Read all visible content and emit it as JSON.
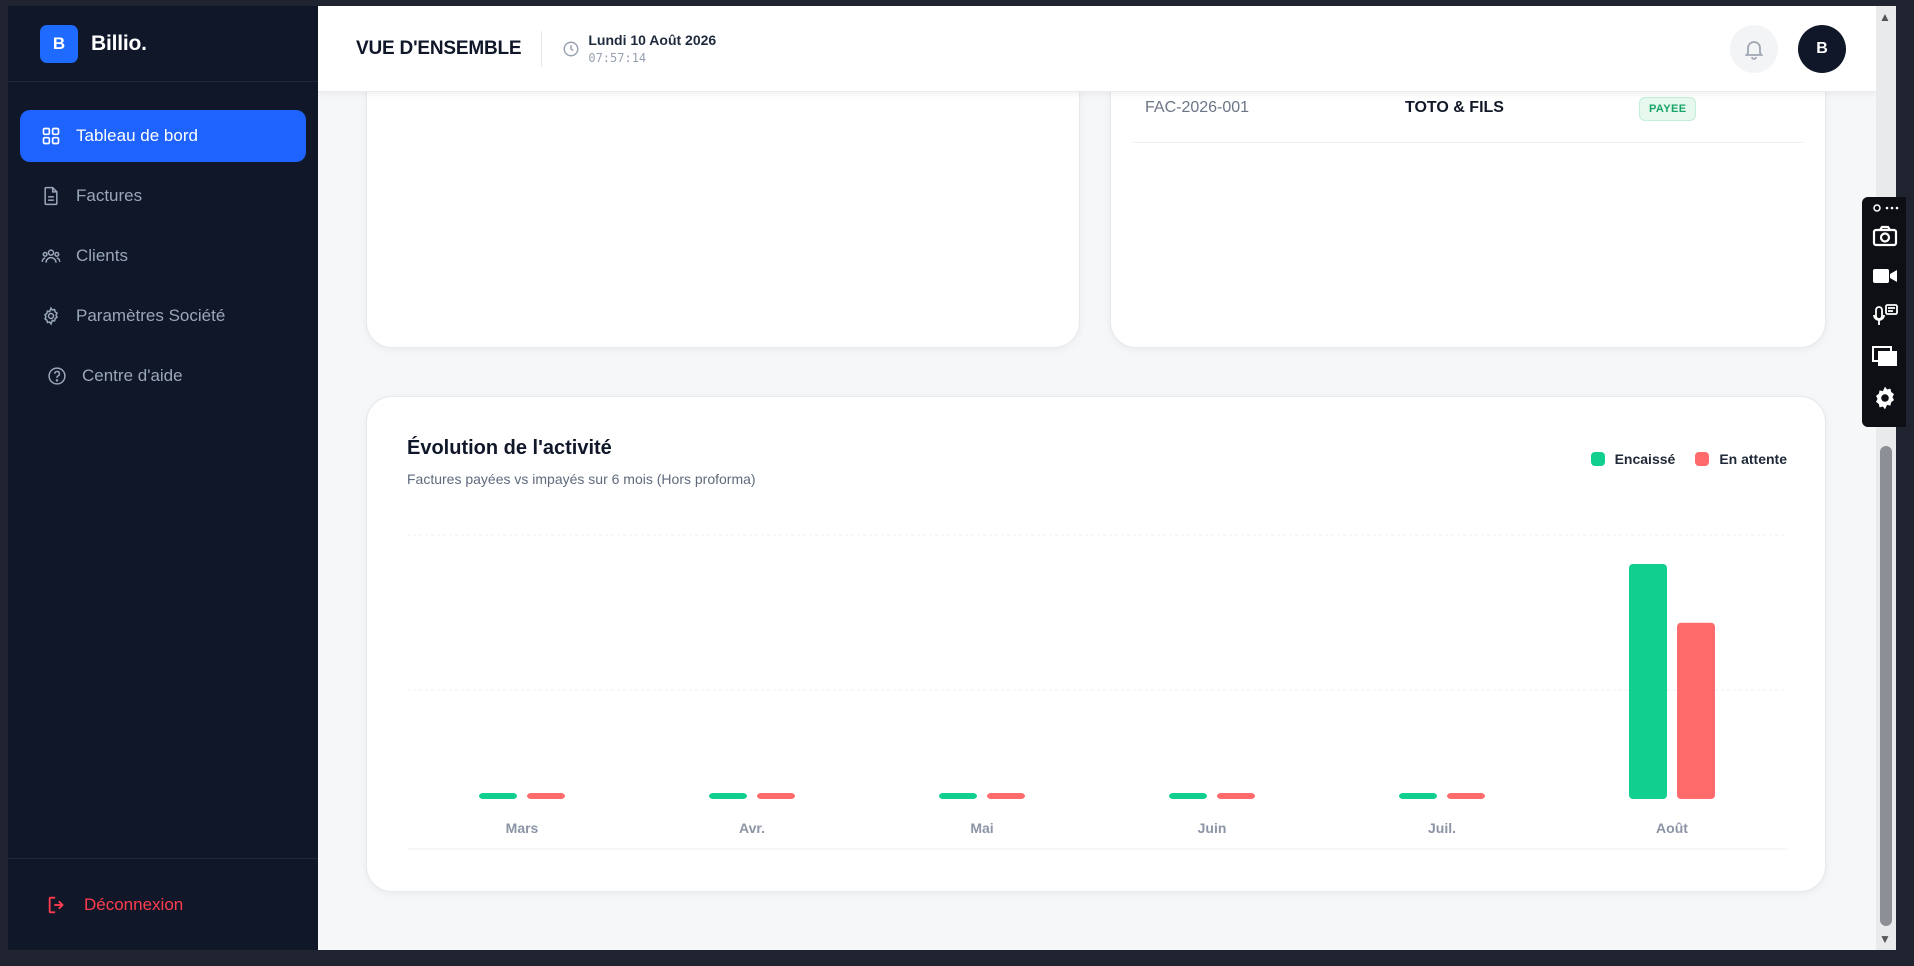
{
  "brand": {
    "logo_letter": "B",
    "name": "Billio."
  },
  "sidebar": {
    "items": [
      {
        "label": "Tableau de bord",
        "icon": "grid-icon",
        "active": true
      },
      {
        "label": "Factures",
        "icon": "document-icon",
        "active": false
      },
      {
        "label": "Clients",
        "icon": "users-icon",
        "active": false
      },
      {
        "label": "Paramètres Société",
        "icon": "gear-icon",
        "active": false
      },
      {
        "label": "Centre d'aide",
        "icon": "help-circle-icon",
        "active": false
      }
    ],
    "logout_label": "Déconnexion"
  },
  "header": {
    "title": "VUE D'ENSEMBLE",
    "date": "Lundi 10 Août 2026",
    "time": "07:57:14",
    "avatar_letter": "B"
  },
  "invoices": {
    "rows": [
      {
        "number": "FAC-2026-001",
        "client": "TOTO & FILS",
        "status": "PAYEE"
      }
    ]
  },
  "chart": {
    "title": "Évolution de l'activité",
    "subtitle": "Factures payées vs impayés sur 6 mois (Hors proforma)"
  },
  "chart_data": {
    "type": "bar",
    "title": "Évolution de l'activité",
    "categories": [
      "Mars",
      "Avr.",
      "Mai",
      "Juin",
      "Juil.",
      "Août"
    ],
    "series": [
      {
        "name": "Encaissé",
        "color": "#10cf8f",
        "values": [
          0,
          0,
          0,
          0,
          0,
          100
        ]
      },
      {
        "name": "En attente",
        "color": "#ff6b6b",
        "values": [
          0,
          0,
          0,
          0,
          0,
          75
        ]
      }
    ],
    "legend": "top-right",
    "grid": true
  },
  "colors": {
    "accent": "#1f63ff",
    "sidebar_bg": "#0f1729",
    "danger": "#ff3d4f"
  }
}
